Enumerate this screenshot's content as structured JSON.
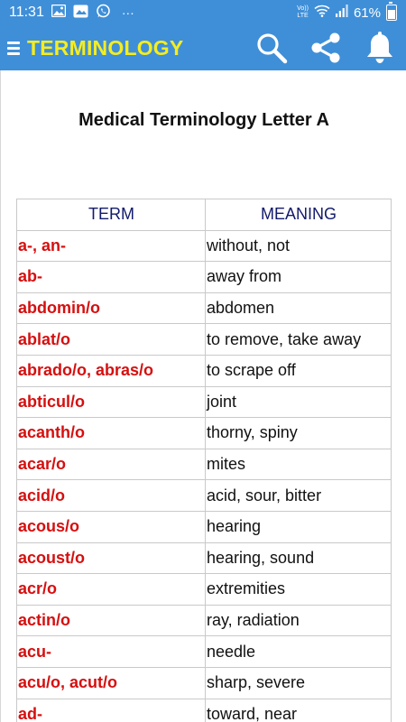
{
  "status_bar": {
    "time": "11:31",
    "overflow": "···",
    "network_badge_top": "Vo))",
    "network_badge_bottom": "LTE",
    "battery_percent": "61%"
  },
  "app_bar": {
    "title": "TERMINOLOGY",
    "icons": [
      "menu-icon",
      "search-icon",
      "share-icon",
      "bell-icon"
    ]
  },
  "page": {
    "title": "Medical Terminology Letter A"
  },
  "table": {
    "headers": [
      "TERM",
      "MEANING"
    ],
    "rows": [
      {
        "term": "a-, an-",
        "meaning": "without, not"
      },
      {
        "term": "ab-",
        "meaning": "away from"
      },
      {
        "term": "abdomin/o",
        "meaning": "abdomen"
      },
      {
        "term": "ablat/o",
        "meaning": "to remove, take away"
      },
      {
        "term": "abrado/o, abras/o",
        "meaning": "to scrape off"
      },
      {
        "term": "abticul/o",
        "meaning": "joint"
      },
      {
        "term": "acanth/o",
        "meaning": "thorny, spiny"
      },
      {
        "term": "acar/o",
        "meaning": "mites"
      },
      {
        "term": "acid/o",
        "meaning": "acid, sour, bitter"
      },
      {
        "term": "acous/o",
        "meaning": "hearing"
      },
      {
        "term": "acoust/o",
        "meaning": "hearing, sound"
      },
      {
        "term": "acr/o",
        "meaning": "extremities"
      },
      {
        "term": "actin/o",
        "meaning": "ray, radiation"
      },
      {
        "term": "acu-",
        "meaning": "needle"
      },
      {
        "term": "acu/o, acut/o",
        "meaning": "sharp, severe"
      },
      {
        "term": "ad-",
        "meaning": "toward, near"
      }
    ]
  },
  "colors": {
    "app_bar": "#3f8fd8",
    "title": "#f5ed20",
    "term": "#d60f0f",
    "header": "#121a6b"
  }
}
